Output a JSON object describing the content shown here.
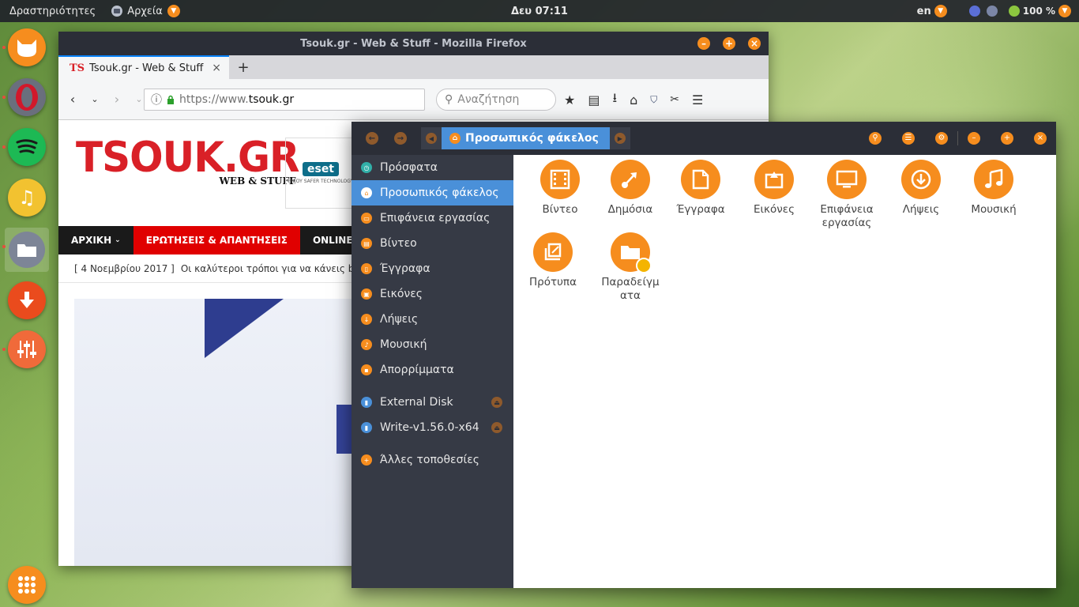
{
  "topbar": {
    "activities": "Δραστηριότητες",
    "app_menu": "Αρχεία",
    "clock": "Δευ 07:11",
    "lang": "en",
    "battery": "100 %"
  },
  "dock": {
    "items": [
      {
        "name": "Firefox"
      },
      {
        "name": "Opera"
      },
      {
        "name": "Spotify"
      },
      {
        "name": "Rhythmbox"
      },
      {
        "name": "Files"
      },
      {
        "name": "Downloader"
      },
      {
        "name": "Mixer"
      }
    ]
  },
  "firefox": {
    "title": "Tsouk.gr - Web & Stuff - Mozilla Firefox",
    "tab_label": "Tsouk.gr - Web & Stuff",
    "tab_favicon": "TS",
    "url_prefix": "https://www.",
    "url_host": "tsouk.gr",
    "search_placeholder": "Αναζήτηση",
    "page": {
      "logo": "TSOUK.GR",
      "logo_sub": "WEB & STUFF",
      "ad_brand": "eset",
      "ad_tag": "ENJOY SAFER TECHNOLOGY",
      "menu": [
        "ΑΡΧΙΚΗ",
        "ΕΡΩΤΗΣΕΙΣ & ΑΠΑΝΤΗΣΕΙΣ",
        "ONLINE TOO"
      ],
      "ticker_date": "[ 4 Νοεμβρίου 2017 ]",
      "ticker_text": "Οι καλύτεροι τρόποι για να κάνεις backu"
    }
  },
  "files": {
    "path_current": "Προσωπικός φάκελος",
    "sidebar": [
      {
        "label": "Πρόσφατα"
      },
      {
        "label": "Προσωπικός φάκελος"
      },
      {
        "label": "Επιφάνεια εργασίας"
      },
      {
        "label": "Βίντεο"
      },
      {
        "label": "Έγγραφα"
      },
      {
        "label": "Εικόνες"
      },
      {
        "label": "Λήψεις"
      },
      {
        "label": "Μουσική"
      },
      {
        "label": "Απορρίμματα"
      },
      {
        "label": "External Disk"
      },
      {
        "label": "Write-v1.56.0-x64"
      },
      {
        "label": "Άλλες τοποθεσίες"
      }
    ],
    "folders": [
      {
        "label": "Βίντεο",
        "icon": "video-icon"
      },
      {
        "label": "Δημόσια",
        "icon": "share-icon"
      },
      {
        "label": "Έγγραφα",
        "icon": "document-icon"
      },
      {
        "label": "Εικόνες",
        "icon": "image-icon"
      },
      {
        "label": "Επιφάνεια εργασίας",
        "icon": "desktop-icon"
      },
      {
        "label": "Λήψεις",
        "icon": "download-icon"
      },
      {
        "label": "Μουσική",
        "icon": "music-icon"
      },
      {
        "label": "Πρότυπα",
        "icon": "template-icon"
      },
      {
        "label": "Παραδείγματα",
        "icon": "examples-icon"
      }
    ]
  },
  "colors": {
    "accent": "#f68d1e",
    "selection": "#4a90d9",
    "sidebar_bg": "#363a45",
    "titlebar_bg": "#2b2e37"
  }
}
